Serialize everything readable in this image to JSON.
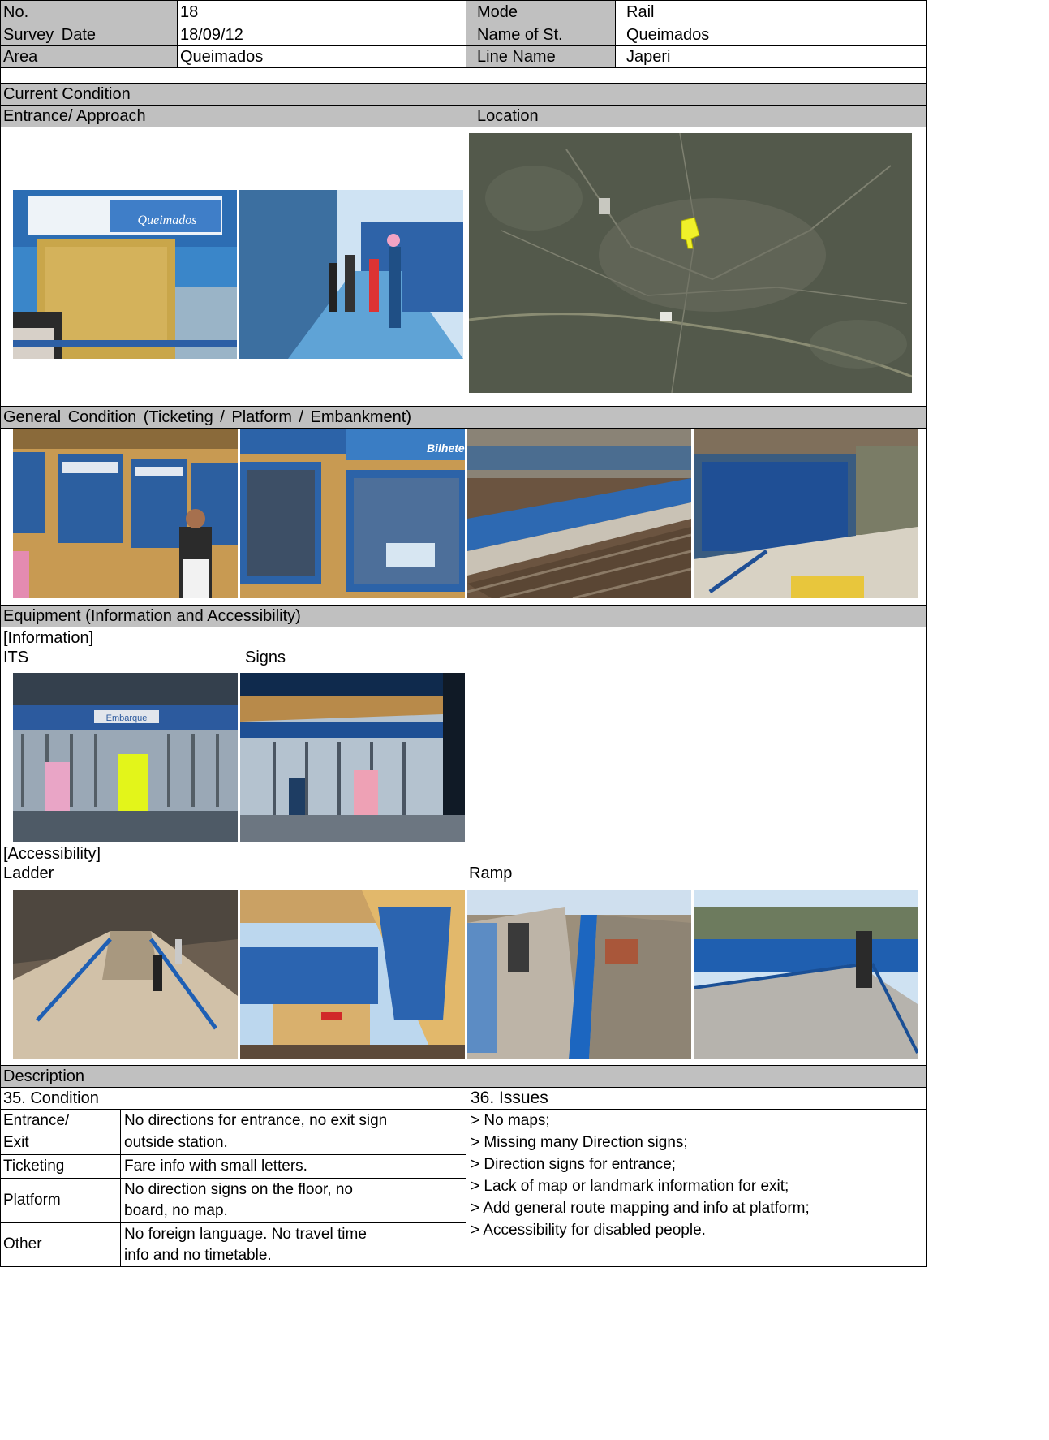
{
  "header": {
    "rows": [
      {
        "label": "No.",
        "value": "18",
        "label2": "Mode",
        "value2": "Rail"
      },
      {
        "label": "Survey Date",
        "value": "18/09/12",
        "label2": "Name of St.",
        "value2": "Queimados"
      },
      {
        "label": "Area",
        "value": "Queimados",
        "label2": "Line Name",
        "value2": "Japeri"
      }
    ]
  },
  "sections": {
    "current_condition": "Current Condition",
    "entrance_approach": "Entrance/ Approach",
    "location": "Location",
    "general_condition": "General Condition (Ticketing / Platform / Embankment)",
    "equipment": "Equipment (Information  and Accessibility)",
    "information": "[Information]",
    "its": "ITS",
    "signs": "Signs",
    "accessibility": "[Accessibility]",
    "ladder": "Ladder",
    "ramp": "Ramp",
    "description": "Description"
  },
  "photos": {
    "entrance_sign_text": "Queimados",
    "ticket_sign_text": "Bilhete",
    "its_sign_text": "Embarque"
  },
  "condition": {
    "title": "35. Condition",
    "rows": [
      {
        "label_lines": [
          "Entrance/",
          "Exit"
        ],
        "text_lines": [
          "No directions for entrance, no exit sign",
          "outside station."
        ]
      },
      {
        "label_lines": [
          "Ticketing"
        ],
        "text_lines": [
          "Fare info with small letters."
        ]
      },
      {
        "label_lines": [
          "Platform"
        ],
        "text_lines": [
          "No direction signs on the floor, no",
          "board, no map."
        ]
      },
      {
        "label_lines": [
          "Other"
        ],
        "text_lines": [
          "No foreign language. No travel time",
          "info and no timetable."
        ]
      }
    ]
  },
  "issues": {
    "title": "36. Issues",
    "items": [
      "> No maps;",
      "> Missing many Direction signs;",
      "> Direction signs for entrance;",
      "> Lack of map or landmark information for exit;",
      "> Add general route mapping and info at platform;",
      "> Accessibility for disabled people."
    ]
  }
}
